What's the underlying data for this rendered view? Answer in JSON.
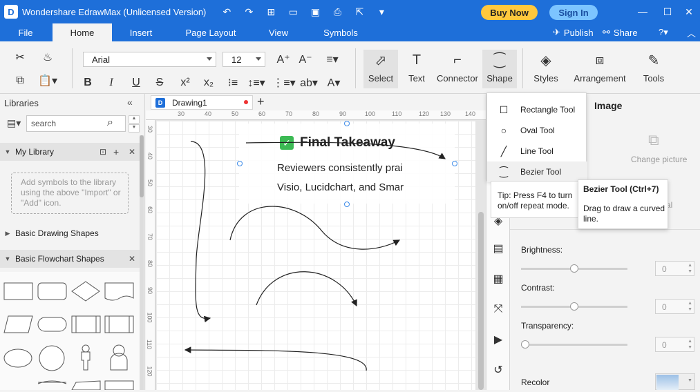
{
  "app": {
    "title": "Wondershare EdrawMax (Unlicensed Version)",
    "logo": "D",
    "buy_now": "Buy Now",
    "sign_in": "Sign In"
  },
  "menu": {
    "tabs": [
      "File",
      "Home",
      "Insert",
      "Page Layout",
      "View",
      "Symbols"
    ],
    "active": "Home",
    "publish": "Publish",
    "share": "Share"
  },
  "ribbon": {
    "font": "Arial",
    "font_size": "12",
    "tools": [
      "Select",
      "Text",
      "Connector",
      "Shape",
      "Styles",
      "Arrangement",
      "Tools"
    ]
  },
  "libraries": {
    "title": "Libraries",
    "search_placeholder": "search",
    "my_library": "My Library",
    "drop_hint": "Add symbols to the library using the above \"Import\" or \"Add\" icon.",
    "basic_drawing": "Basic Drawing Shapes",
    "basic_flowchart": "Basic Flowchart Shapes"
  },
  "document": {
    "tab_name": "Drawing1",
    "text_title": "Final Takeaway",
    "text_line1": "Reviewers consistently prai",
    "text_line2": "Visio, Lucidchart, and Smar"
  },
  "ruler": {
    "h": [
      "30",
      "40",
      "50",
      "60",
      "70",
      "80",
      "90",
      "100",
      "110",
      "120",
      "130",
      "140"
    ],
    "v": [
      "30",
      "40",
      "50",
      "60",
      "70",
      "80",
      "90",
      "100",
      "110",
      "120"
    ]
  },
  "shape_menu": {
    "items": [
      "Rectangle Tool",
      "Oval Tool",
      "Line Tool",
      "Bezier Tool"
    ],
    "hover_tip": "Tip: Press F4 to turn on/off repeat mode.",
    "tooltip_title": "Bezier Tool (Ctrl+7)",
    "tooltip_desc": "Drag to draw a curved line."
  },
  "image_panel": {
    "title": "Image",
    "change_picture": "Change picture",
    "brightness": "Brightness:",
    "contrast": "Contrast:",
    "transparency": "Transparency:",
    "recolor": "Recolor",
    "brightness_value": "0",
    "contrast_value": "0",
    "transparency_value": "0",
    "brightness_level": 0.5,
    "contrast_level": 0.5,
    "transparency_level": 0.0,
    "partial_label": "al"
  },
  "colors": {
    "accent": "#1e6fd9",
    "buy_now": "#ffc83d",
    "sign_in": "#7cc4ff",
    "check_green": "#3cba54",
    "handle_blue": "#3d8be8"
  }
}
